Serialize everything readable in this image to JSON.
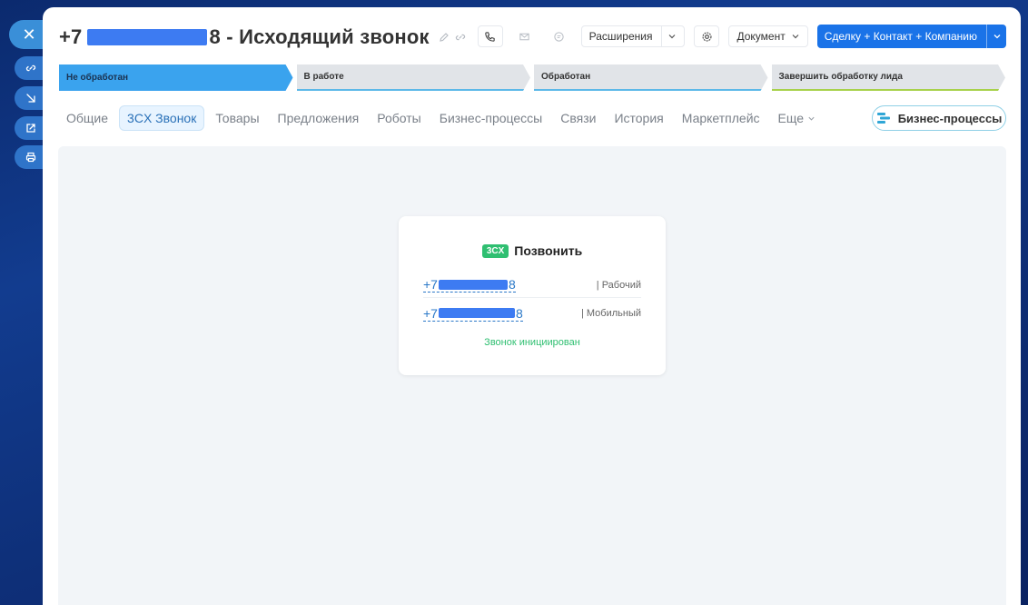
{
  "window": {
    "title_prefix": "+7",
    "title_suffix": "8 - Исходящий звонок"
  },
  "toolbar": {
    "extensions_label": "Расширения",
    "document_label": "Документ",
    "create_label": "Сделку + Контакт + Компанию"
  },
  "stages": [
    {
      "label": "Не обработан"
    },
    {
      "label": "В работе"
    },
    {
      "label": "Обработан"
    },
    {
      "label": "Завершить обработку лида"
    }
  ],
  "tabs": [
    {
      "label": "Общие"
    },
    {
      "label": "3CX Звонок"
    },
    {
      "label": "Товары"
    },
    {
      "label": "Предложения"
    },
    {
      "label": "Роботы"
    },
    {
      "label": "Бизнес-процессы"
    },
    {
      "label": "Связи"
    },
    {
      "label": "История"
    },
    {
      "label": "Маркетплейс"
    },
    {
      "label": "Еще"
    }
  ],
  "bp_button_label": "Бизнес-процессы",
  "call_card": {
    "badge": "3CX",
    "title": "Позвонить",
    "phones": [
      {
        "prefix": "+7",
        "suffix": "8",
        "type": "| Рабочий"
      },
      {
        "prefix": "+7",
        "suffix": "8",
        "type": "| Мобильный"
      }
    ],
    "status": "Звонок инициирован"
  }
}
